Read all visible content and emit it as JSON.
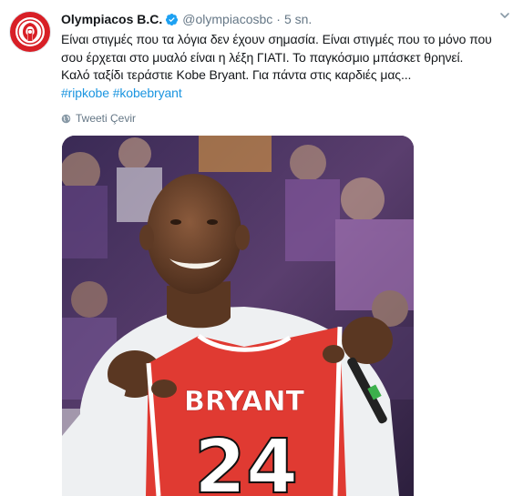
{
  "account": {
    "name": "Olympiacos B.C.",
    "handle": "@olympiacosbc",
    "separator": "·",
    "time": "5 sn."
  },
  "tweet": {
    "lines": [
      "Είναι στιγμές που τα λόγια δεν έχουν σημασία. Είναι στιγμές που το μόνο που",
      "σου έρχεται στο μυαλό είναι η λέξη ΓΙΑΤΙ. Το παγκόσμιο μπάσκετ θρηνεί.",
      "Καλό ταξίδι τεράστιε Kobe Bryant. Για πάντα στις καρδιές μας..."
    ],
    "hashtags": [
      "#ripkobe",
      "#kobebryant"
    ]
  },
  "translate_label": "Tweeti Çevir",
  "media": {
    "jersey_name": "BRYANT",
    "jersey_number": "24"
  },
  "icons": {
    "avatar": "olympiacos-logo-icon",
    "verified": "verified-badge-icon",
    "menu": "chevron-down-icon",
    "translate": "globe-icon"
  },
  "colors": {
    "brand_red": "#d81f26",
    "link_blue": "#1b95e0",
    "muted_gray": "#657786",
    "text": "#14171a"
  }
}
